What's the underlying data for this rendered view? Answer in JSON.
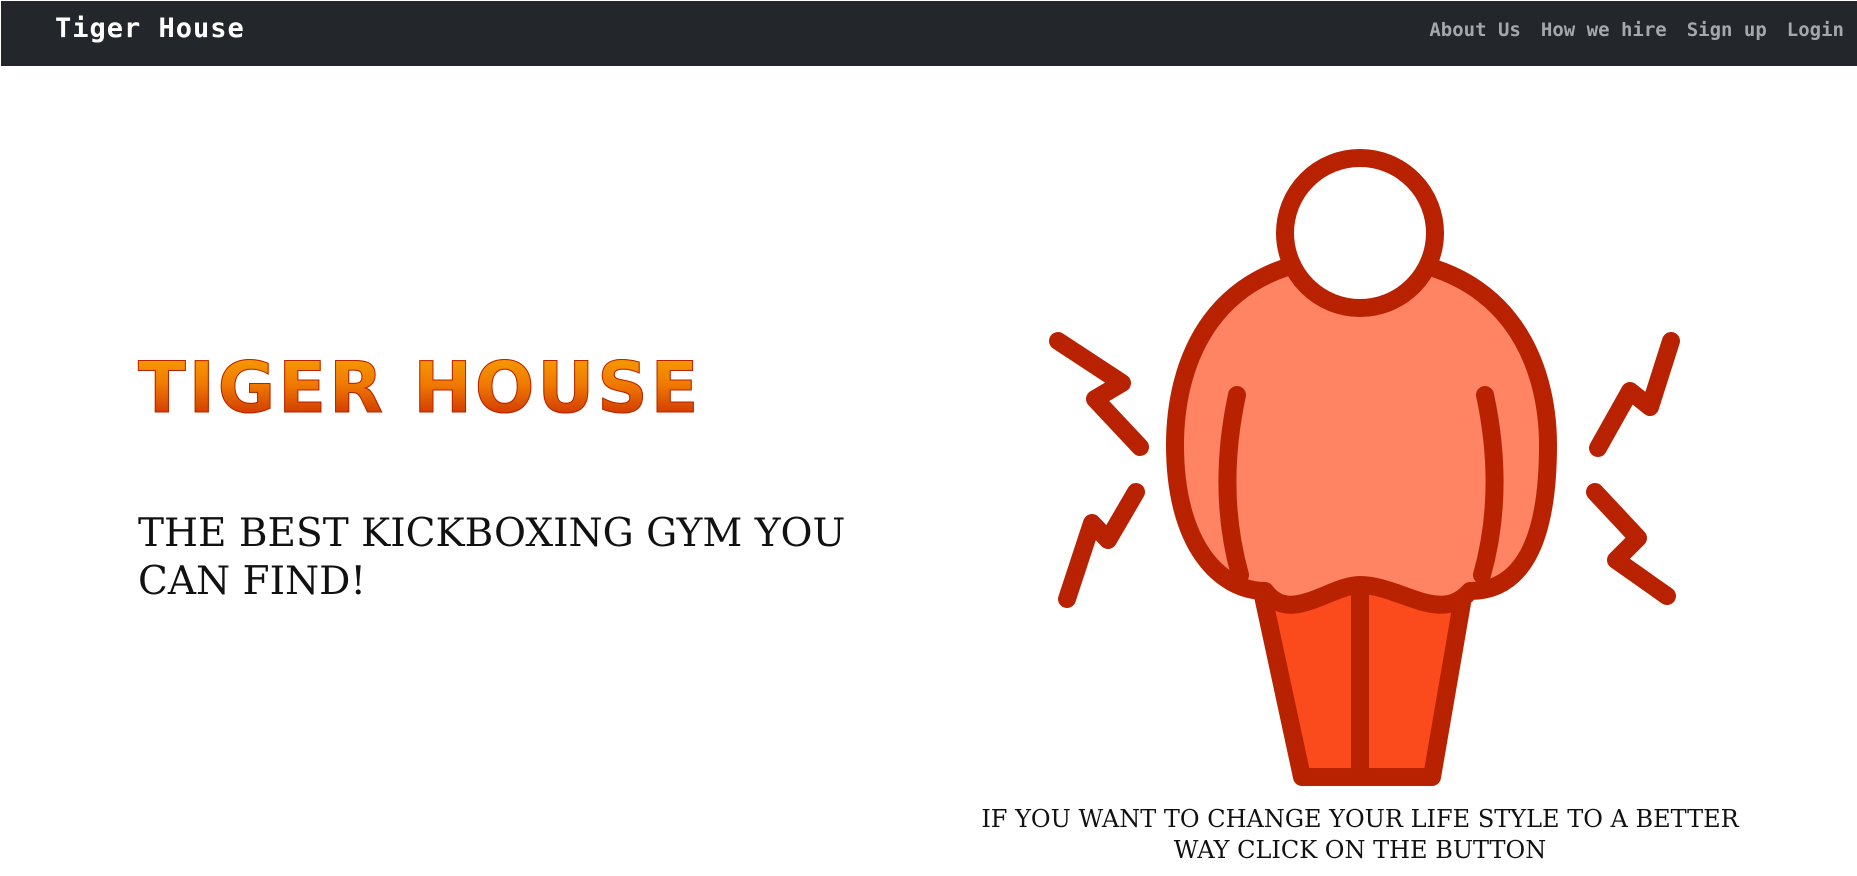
{
  "navbar": {
    "brand": "Tiger House",
    "links": [
      "About Us",
      "How we hire",
      "Sign up",
      "Login"
    ]
  },
  "hero": {
    "title": "TIGER HOUSE",
    "tagline": "THE BEST KICKBOXING GYM YOU CAN FIND!",
    "cta_text": "IF YOU WANT TO CHANGE YOUR LIFE STYLE TO A BETTER WAY CLICK ON THE BUTTON"
  },
  "illustration": {
    "icon": "overweight-person-icon",
    "colors": {
      "outline": "#b82200",
      "body": "#ff8464",
      "legs": "#fb4a1b"
    }
  },
  "colors": {
    "navbar_bg": "#23272b",
    "nav_link": "#a5a8ab",
    "brand": "#ffffff",
    "title_gradient_top": "#f7a600",
    "title_gradient_bottom": "#c41e00"
  }
}
